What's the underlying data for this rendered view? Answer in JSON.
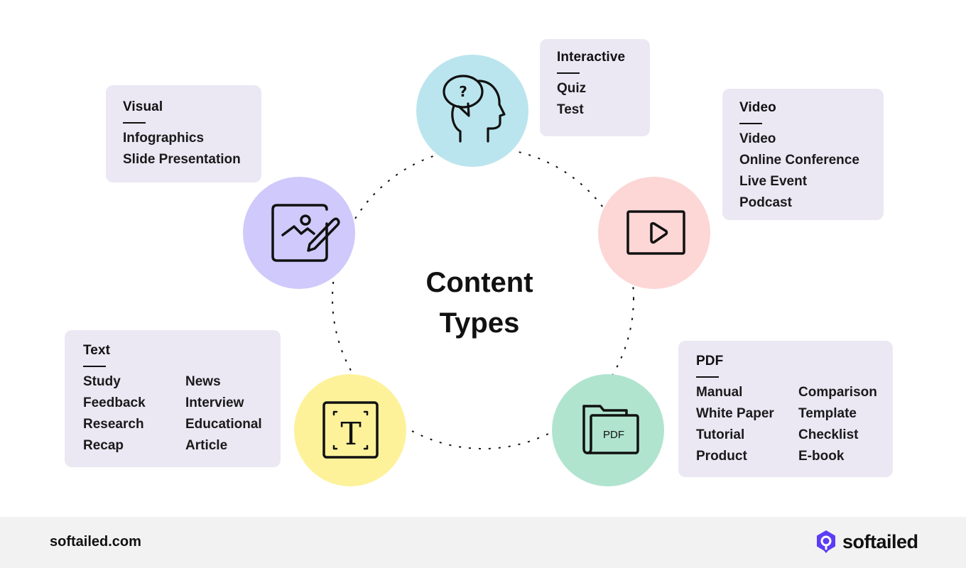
{
  "title": {
    "line1": "Content",
    "line2": "Types"
  },
  "colors": {
    "interactive": "#bbe5ee",
    "visual": "#d0c9fb",
    "video": "#fdd6d6",
    "text": "#fdf29a",
    "pdf": "#b0e4cf",
    "card_bg": "#ebe8f4",
    "brand": "#5b3df5"
  },
  "nodes": [
    {
      "id": "interactive",
      "icon": "head-question-icon"
    },
    {
      "id": "visual",
      "icon": "image-edit-icon"
    },
    {
      "id": "video",
      "icon": "video-play-icon"
    },
    {
      "id": "text",
      "icon": "text-frame-icon"
    },
    {
      "id": "pdf",
      "icon": "pdf-folder-icon",
      "icon_label": "PDF"
    }
  ],
  "cards": {
    "interactive": {
      "heading": "Interactive",
      "items": [
        "Quiz",
        "Test"
      ]
    },
    "visual": {
      "heading": "Visual",
      "items": [
        "Infographics",
        "Slide Presentation"
      ]
    },
    "video": {
      "heading": "Video",
      "items": [
        "Video",
        "Online Conference",
        "Live Event",
        "Podcast"
      ]
    },
    "text": {
      "heading": "Text",
      "items": [
        "Study",
        "News",
        "Feedback",
        "Interview",
        "Research",
        "Educational",
        "Recap",
        "Article"
      ]
    },
    "pdf": {
      "heading": "PDF",
      "items": [
        "Manual",
        "Comparison",
        "White Paper",
        "Template",
        "Tutorial",
        "Checklist",
        "Product",
        "E-book"
      ]
    }
  },
  "footer": {
    "url": "softailed.com",
    "brand": "softailed"
  }
}
